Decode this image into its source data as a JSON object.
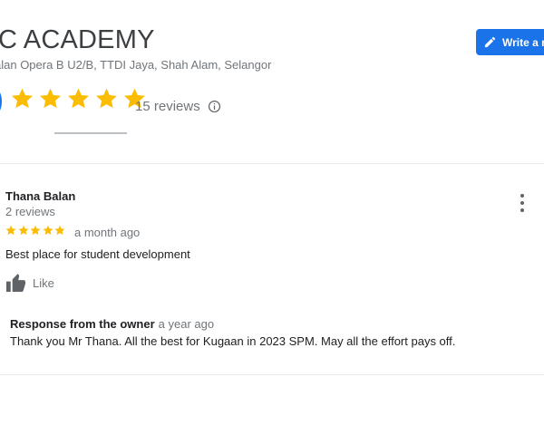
{
  "business": {
    "name": "C ACADEMY",
    "address": "alan Opera B U2/B, TTDI Jaya, Shah Alam, Selangor",
    "write_review_label": "Write a review",
    "rating_stars": 5,
    "total_reviews": "15 reviews"
  },
  "review": {
    "author": "Thana Balan",
    "author_reviews": "2 reviews",
    "stars": 5,
    "date": "a month ago",
    "text": "Best place for student development",
    "like_label": "Like"
  },
  "owner_response": {
    "title": "Response from the owner",
    "date": "a year ago",
    "text": "Thank you Mr Thana. All the best for Kugaan in 2023 SPM. May all the effort pays off."
  },
  "colors": {
    "star": "#fbbc04",
    "accent": "#1a73e8"
  },
  "icons": [
    "pencil-icon",
    "info-icon",
    "more-vert-icon",
    "thumb-up-icon",
    "star-icon"
  ]
}
